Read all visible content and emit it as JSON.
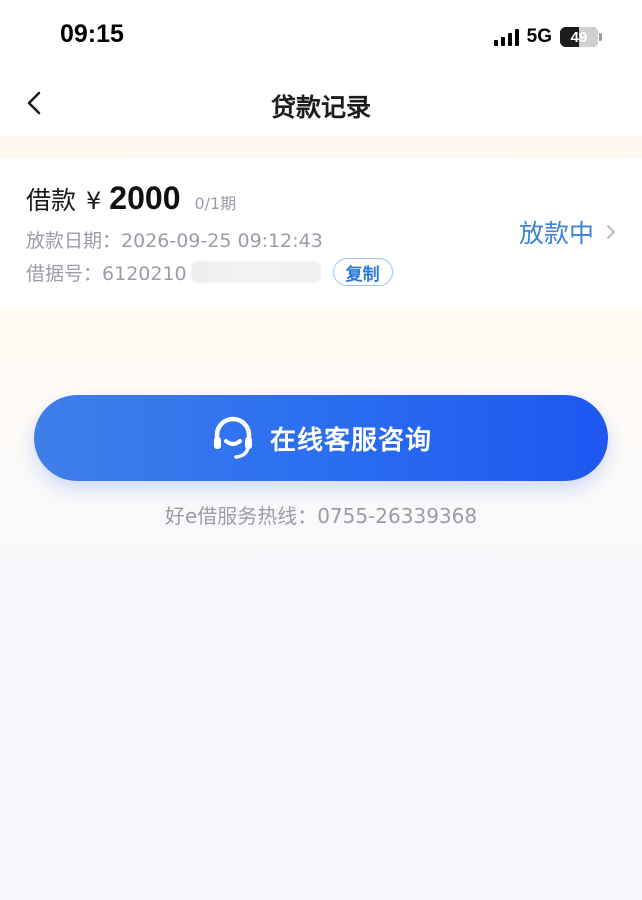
{
  "status_bar": {
    "time": "09:15",
    "network": "5G",
    "battery": "49",
    "signal_icon": "signal-bars-icon",
    "battery_icon": "battery-icon"
  },
  "nav": {
    "title": "贷款记录",
    "back_icon": "chevron-left-icon"
  },
  "loan": {
    "label": "借款",
    "currency": "¥",
    "amount": "2000",
    "term": "0/1期",
    "date_label": "放款日期：",
    "date_value": "2026-09-25 09:12:43",
    "id_label": "借据号：",
    "id_value": "6120210",
    "copy_label": "复制",
    "status": "放款中",
    "status_color": "#3b83d8"
  },
  "consult": {
    "label": "在线客服咨询",
    "icon": "headset-icon",
    "color": "#2b6ef0"
  },
  "hotline": {
    "text": "好e借服务热线：0755-26339368"
  }
}
